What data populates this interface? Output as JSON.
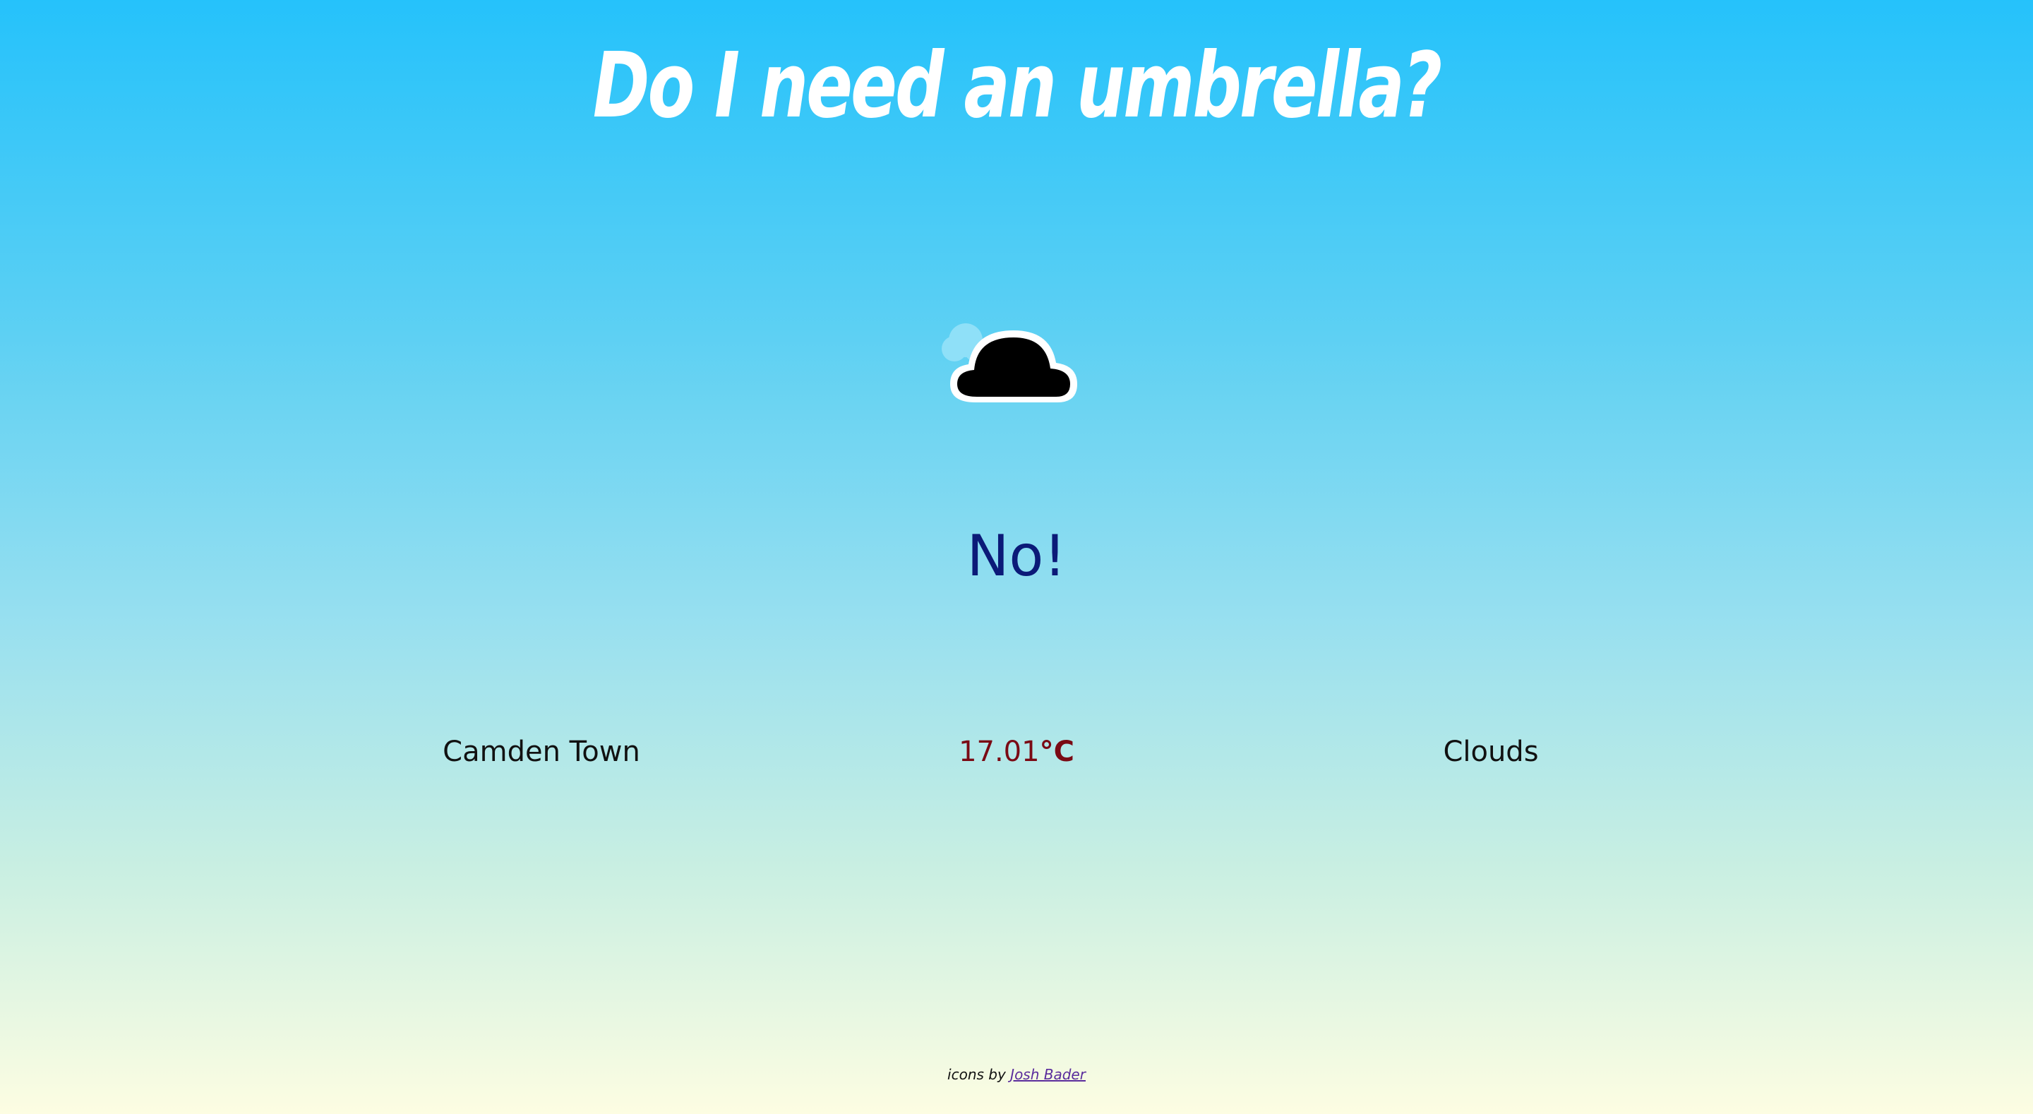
{
  "header": {
    "title": "Do I need an umbrella?"
  },
  "weather": {
    "icon": "cloud-icon",
    "answer": "No!",
    "location": "Camden Town",
    "temperature_value": "17.01",
    "temperature_unit": "°C",
    "condition": "Clouds"
  },
  "footer": {
    "credit_prefix": "icons by",
    "credit_link_text": "Josh Bader"
  },
  "colors": {
    "gradient_top": "#25c2fb",
    "gradient_bottom": "#fdfde2",
    "title": "#ffffff",
    "answer": "#0b1a78",
    "temperature": "#7a0a14",
    "link": "#5a2c9c"
  }
}
